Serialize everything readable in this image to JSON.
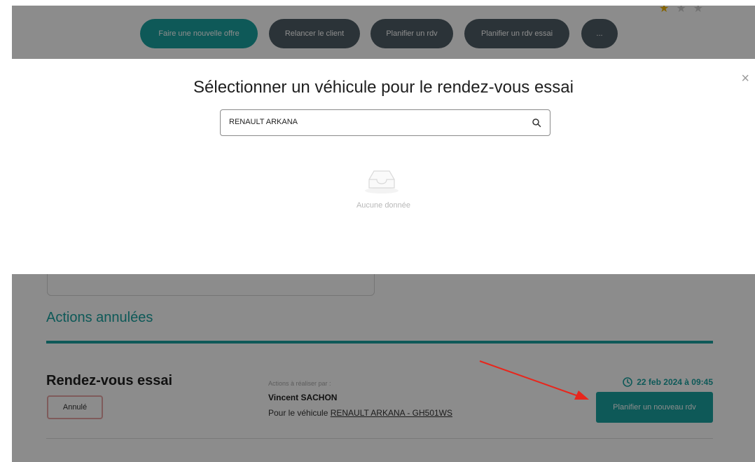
{
  "top_actions": {
    "new_offer": "Faire une nouvelle offre",
    "remind_client": "Relancer le client",
    "plan_rdv": "Planifier un rdv",
    "plan_test_rdv": "Planifier un rdv essai",
    "more": "..."
  },
  "modal": {
    "title": "Sélectionner un véhicule pour le rendez-vous essai",
    "search_value": "RENAULT ARKANA",
    "empty_text": "Aucune donnée",
    "close_label": "×"
  },
  "page": {
    "section_title": "Actions annulées",
    "card_title": "Rendez-vous essai",
    "status": "Annulé",
    "assigned_caption": "Actions à réaliser par :",
    "assignee": "Vincent SACHON",
    "vehicle_prefix": "Pour le véhicule ",
    "vehicle_link": "RENAULT ARKANA - GH501WS",
    "date": "22 feb 2024 à 09:45",
    "cta": "Planifier un nouveau rdv"
  },
  "colors": {
    "accent": "#1aa3a0",
    "dark_pill": "#4f5e66",
    "annotation_arrow": "#e8261c"
  }
}
